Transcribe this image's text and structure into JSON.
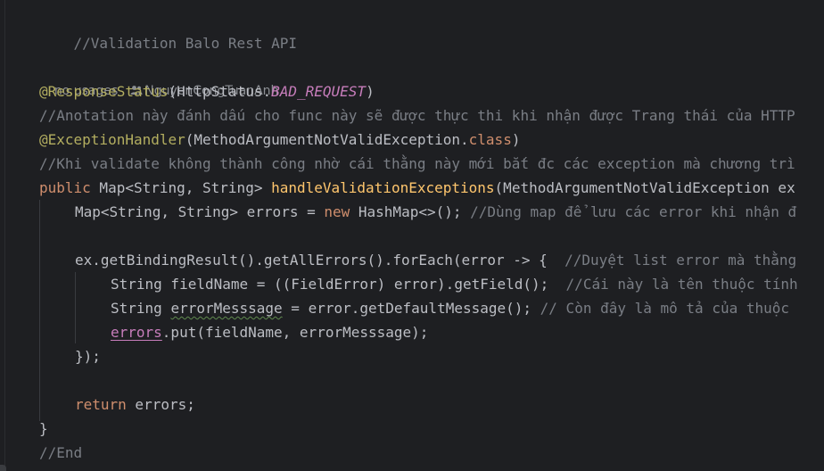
{
  "editor": {
    "inlay_hint": {
      "usages": "no usages",
      "author": "NguyenCongTuanAnh"
    },
    "code": {
      "l1_comment": "//Validation Balo Rest API",
      "l3_annotation": "@ResponseStatus",
      "l3_args_open": "(HttpStatus.",
      "l3_const": "BAD_REQUEST",
      "l3_args_close": ")",
      "l4_comment": "//Anotation này đánh dấu cho func này sẽ được thực thi khi nhận được Trang thái của HTTP",
      "l5_annotation": "@ExceptionHandler",
      "l5_args_open": "(MethodArgumentNotValidException.",
      "l5_class_kw": "class",
      "l5_args_close": ")",
      "l6_comment": "//Khi validate không thành công nhờ cái thằng này mới bắt đc các exception mà chương trì",
      "l7_kw": "public",
      "l7_type": " Map<String, String> ",
      "l7_method": "handleValidationExceptions",
      "l7_params": "(MethodArgumentNotValidException ex",
      "l8_type": "Map<String, String> errors = ",
      "l8_kw": "new",
      "l8_rest": " HashMap<>(); ",
      "l8_comment": "//Dùng map để lưu các error khi nhận đ",
      "l10_code": "ex.getBindingResult().getAllErrors().forEach(error -> {  ",
      "l10_comment": "//Duyệt list error mà thằng",
      "l11_code": "String fieldName = ((FieldError) error).getField();  ",
      "l11_comment": "//Cái này là tên thuộc tính",
      "l12_code_a": "String ",
      "l12_var": "errorMesssage",
      "l12_code_b": " = error.getDefaultMessage(); ",
      "l12_comment": "// Còn đây là mô tả của thuộc",
      "l13_field": "errors",
      "l13_rest": ".put(fieldName, errorMesssage);",
      "l14_code": "});",
      "l16_kw": "return",
      "l16_rest": " errors;",
      "l17_code": "}",
      "l18_comment": "//End"
    }
  }
}
